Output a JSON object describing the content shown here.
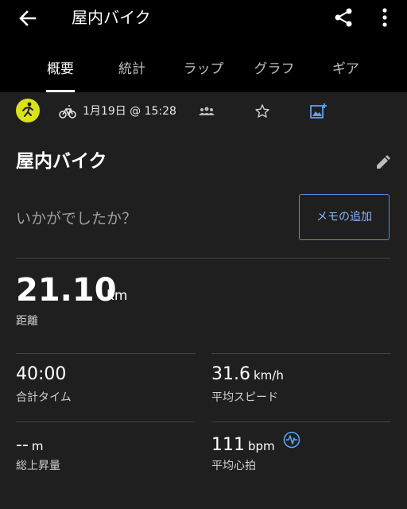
{
  "header": {
    "title": "屋内バイク"
  },
  "tabs": [
    {
      "label": "概要",
      "active": true
    },
    {
      "label": "統計",
      "active": false
    },
    {
      "label": "ラップ",
      "active": false
    },
    {
      "label": "グラフ",
      "active": false
    },
    {
      "label": "ギア",
      "active": false
    }
  ],
  "info": {
    "datetime": "1月19日 @ 15:28"
  },
  "activity": {
    "name": "屋内バイク",
    "question": "いかがでしたか？",
    "memo_button": "メモの追加"
  },
  "stats": {
    "distance": {
      "value": "21.10",
      "unit": "km",
      "label": "距離"
    },
    "total_time": {
      "value": "40:00",
      "unit": "",
      "label": "合計タイム"
    },
    "avg_speed": {
      "value": "31.6",
      "unit": "km/h",
      "label": "平均スピード"
    },
    "elev_gain": {
      "value": "--",
      "unit": "m",
      "label": "総上昇量"
    },
    "avg_hr": {
      "value": "111",
      "unit": "bpm",
      "label": "平均心拍"
    }
  },
  "colors": {
    "background": "#1f1f1f",
    "topbar": "#000000",
    "accent": "#4a90e2",
    "avatar": "#d9e21a"
  },
  "icons": [
    "back-arrow-icon",
    "share-icon",
    "more-vert-icon",
    "runner-icon",
    "bike-icon",
    "group-icon",
    "star-icon",
    "add-photo-icon",
    "pencil-icon",
    "heart-rate-icon"
  ]
}
